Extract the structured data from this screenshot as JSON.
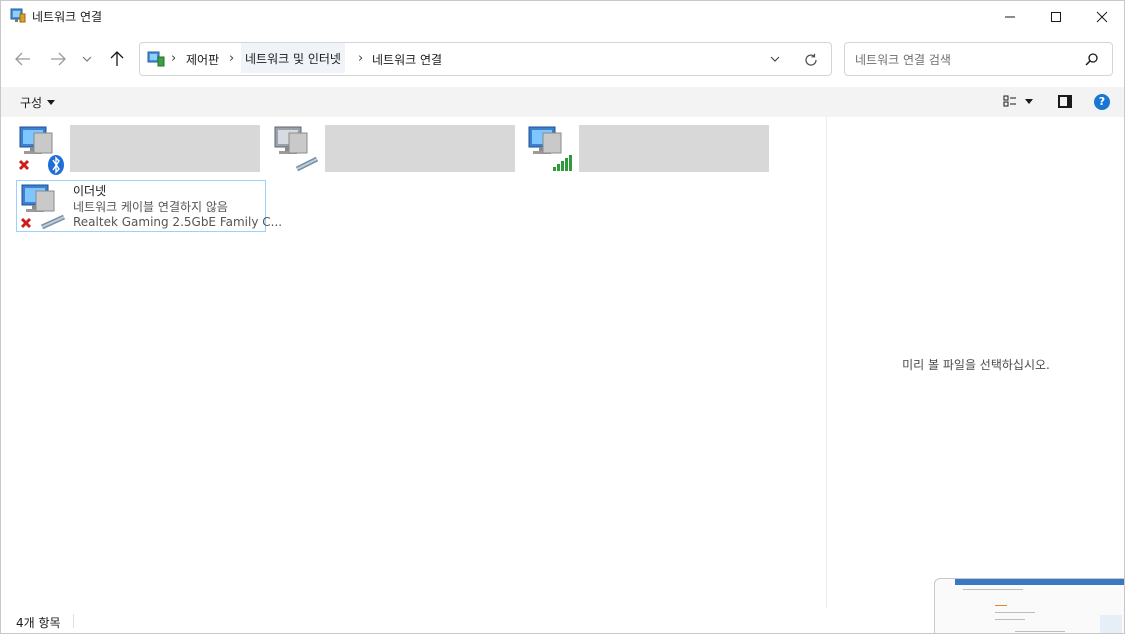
{
  "window": {
    "title": "네트워크 연결"
  },
  "navigation": {
    "breadcrumbs": [
      "제어판",
      "네트워크 및 인터넷",
      "네트워크 연결"
    ],
    "search_placeholder": "네트워크 연결 검색"
  },
  "command_bar": {
    "organize_label": "구성",
    "help_label": "?"
  },
  "connections": [
    {
      "icon": "network-bluetooth-disconnected-icon",
      "redacted": true
    },
    {
      "icon": "network-cable-icon",
      "redacted": true
    },
    {
      "icon": "network-wifi-signal-icon",
      "redacted": true
    },
    {
      "icon": "network-ethernet-disconnected-icon",
      "name": "이더넷",
      "status": "네트워크 케이블 연결하지 않음",
      "adapter": "Realtek Gaming 2.5GbE Family C..."
    }
  ],
  "preview_pane": {
    "message": "미리 볼 파일을 선택하십시오."
  },
  "status_bar": {
    "item_count": "4개 항목"
  },
  "colors": {
    "accent": "#1976d2",
    "selection_border": "#99d1ff",
    "redacted": "#d8d8d8"
  }
}
